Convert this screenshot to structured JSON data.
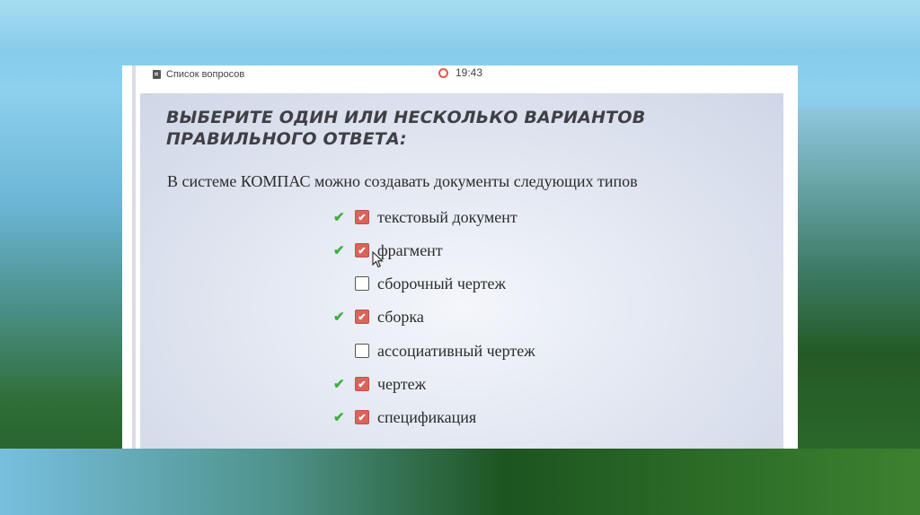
{
  "header": {
    "question_list_label": "Список вопросов",
    "timer": "19:43"
  },
  "question": {
    "heading": "ВЫБЕРИТЕ ОДИН ИЛИ НЕСКОЛЬКО ВАРИАНТОВ ПРАВИЛЬНОГО ОТВЕТА:",
    "text": "В системе КОМПАС можно создавать документы следующих типов"
  },
  "options": [
    {
      "label": "текстовый документ",
      "checked": true,
      "correct": true
    },
    {
      "label": "фрагмент",
      "checked": true,
      "correct": true
    },
    {
      "label": "сборочный чертеж",
      "checked": false,
      "correct": false
    },
    {
      "label": "сборка",
      "checked": true,
      "correct": true
    },
    {
      "label": "ассоциативный чертеж",
      "checked": false,
      "correct": false
    },
    {
      "label": "чертеж",
      "checked": true,
      "correct": true
    },
    {
      "label": "спецификация",
      "checked": true,
      "correct": true
    }
  ],
  "colors": {
    "checkbox_checked": "#d9645a",
    "correct_mark": "#3fae3f",
    "timer_icon": "#e05a4a"
  },
  "icons": {
    "question_list": "list-icon",
    "timer": "timer-icon",
    "correct": "checkmark-icon",
    "cursor": "mouse-cursor-icon"
  }
}
